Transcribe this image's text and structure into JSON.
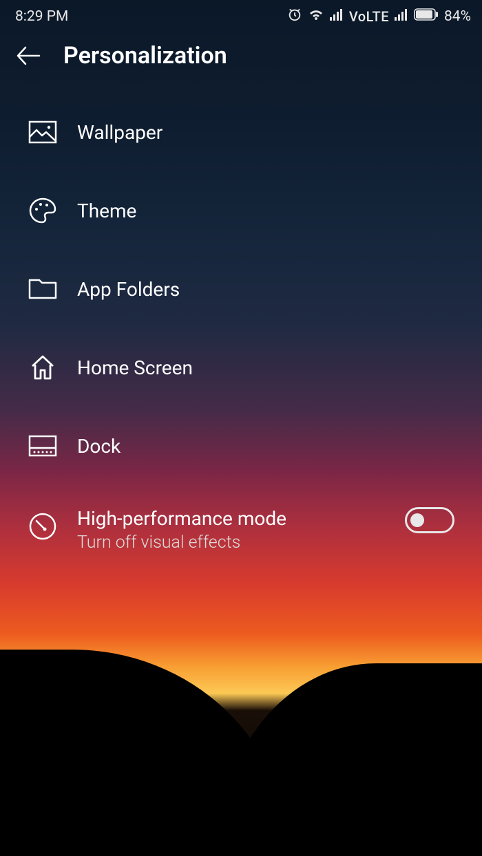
{
  "statusBar": {
    "time": "8:29 PM",
    "volte": "VoLTE",
    "batteryPercent": "84%"
  },
  "header": {
    "title": "Personalization"
  },
  "items": [
    {
      "label": "Wallpaper"
    },
    {
      "label": "Theme"
    },
    {
      "label": "App Folders"
    },
    {
      "label": "Home Screen"
    },
    {
      "label": "Dock"
    },
    {
      "label": "High-performance mode",
      "sublabel": "Turn off visual effects"
    }
  ]
}
